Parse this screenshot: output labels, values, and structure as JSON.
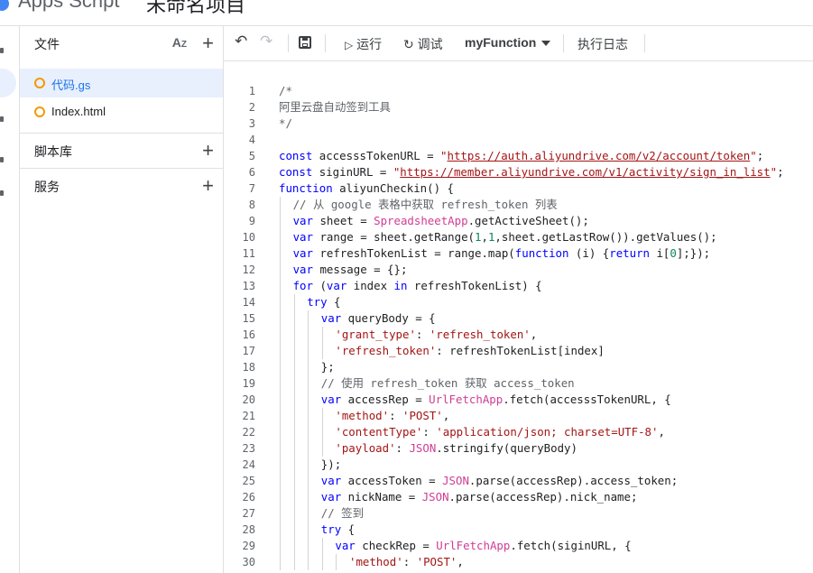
{
  "header": {
    "app_title": "Apps Script",
    "project_name": "未命名项目"
  },
  "sidebar": {
    "files_label": "文件",
    "files": [
      {
        "name": "代码.gs",
        "active": true
      },
      {
        "name": "Index.html",
        "active": false
      }
    ],
    "libraries_label": "脚本库",
    "services_label": "服务"
  },
  "toolbar": {
    "undo_icon": "undo-icon",
    "redo_icon": "redo-icon",
    "save_icon": "save-icon",
    "run_label": "运行",
    "debug_label": "调试",
    "function_select": "myFunction",
    "log_label": "执行日志"
  },
  "colors": {
    "accent": "#1a73e8",
    "active_bg": "#e8f0fe",
    "file_dot": "#f29900",
    "keyword": "#0000ff",
    "string": "#a31515",
    "class": "#d03d93",
    "number": "#098658"
  },
  "editor": {
    "lines": [
      {
        "n": 1,
        "indent": 0,
        "code": [
          [
            "cmt",
            "/*"
          ]
        ]
      },
      {
        "n": 2,
        "indent": 0,
        "code": [
          [
            "cmt",
            "阿里云盘自动签到工具"
          ]
        ]
      },
      {
        "n": 3,
        "indent": 0,
        "code": [
          [
            "cmt",
            "*/"
          ]
        ]
      },
      {
        "n": 4,
        "indent": 0,
        "code": []
      },
      {
        "n": 5,
        "indent": 0,
        "code": [
          [
            "kw",
            "const"
          ],
          [
            "",
            "accesssTokenURL = "
          ],
          [
            "str",
            "\""
          ],
          [
            "url",
            "https://auth.aliyundrive.com/v2/account/token"
          ],
          [
            "str",
            "\""
          ],
          [
            "",
            ";"
          ]
        ]
      },
      {
        "n": 6,
        "indent": 0,
        "code": [
          [
            "kw",
            "const"
          ],
          [
            "",
            "siginURL = "
          ],
          [
            "str",
            "\""
          ],
          [
            "url",
            "https://member.aliyundrive.com/v1/activity/sign_in_list"
          ],
          [
            "str",
            "\""
          ],
          [
            "",
            ";"
          ]
        ]
      },
      {
        "n": 7,
        "indent": 0,
        "code": [
          [
            "kw",
            "function"
          ],
          [
            "",
            "aliyunCheckin() {"
          ]
        ]
      },
      {
        "n": 8,
        "indent": 1,
        "code": [
          [
            "cmt",
            "// 从 google 表格中获取 refresh_token 列表"
          ]
        ]
      },
      {
        "n": 9,
        "indent": 1,
        "code": [
          [
            "kw",
            "var"
          ],
          [
            "",
            "sheet = "
          ],
          [
            "cls",
            "SpreadsheetApp"
          ],
          [
            "",
            ".getActiveSheet();"
          ]
        ]
      },
      {
        "n": 10,
        "indent": 1,
        "code": [
          [
            "kw",
            "var"
          ],
          [
            "",
            "range = sheet.getRange("
          ],
          [
            "num",
            "1"
          ],
          [
            "",
            ","
          ],
          [
            "num",
            "1"
          ],
          [
            "",
            ",sheet.getLastRow()).getValues();"
          ]
        ]
      },
      {
        "n": 11,
        "indent": 1,
        "code": [
          [
            "kw",
            "var"
          ],
          [
            "",
            "refreshTokenList = range.map("
          ],
          [
            "kw",
            "function"
          ],
          [
            "",
            "(i) {"
          ],
          [
            "kw",
            "return"
          ],
          [
            "",
            "i["
          ],
          [
            "num",
            "0"
          ],
          [
            "",
            "];});"
          ]
        ]
      },
      {
        "n": 12,
        "indent": 1,
        "code": [
          [
            "kw",
            "var"
          ],
          [
            "",
            "message = {};"
          ]
        ]
      },
      {
        "n": 13,
        "indent": 1,
        "code": [
          [
            "kw",
            "for"
          ],
          [
            "",
            "("
          ],
          [
            "kw",
            "var"
          ],
          [
            "",
            "index "
          ],
          [
            "kw",
            "in"
          ],
          [
            "",
            "refreshTokenList) {"
          ]
        ]
      },
      {
        "n": 14,
        "indent": 2,
        "code": [
          [
            "kw",
            "try"
          ],
          [
            "",
            "{"
          ]
        ]
      },
      {
        "n": 15,
        "indent": 3,
        "code": [
          [
            "kw",
            "var"
          ],
          [
            "",
            "queryBody = {"
          ]
        ]
      },
      {
        "n": 16,
        "indent": 4,
        "code": [
          [
            "str",
            "'grant_type'"
          ],
          [
            "",
            ": "
          ],
          [
            "str",
            "'refresh_token'"
          ],
          [
            "",
            ","
          ]
        ]
      },
      {
        "n": 17,
        "indent": 4,
        "code": [
          [
            "str",
            "'refresh_token'"
          ],
          [
            "",
            ": refreshTokenList[index]"
          ]
        ]
      },
      {
        "n": 18,
        "indent": 3,
        "code": [
          [
            "",
            "};"
          ]
        ]
      },
      {
        "n": 19,
        "indent": 3,
        "code": [
          [
            "cmt",
            "// 使用 refresh_token 获取 access_token"
          ]
        ]
      },
      {
        "n": 20,
        "indent": 3,
        "code": [
          [
            "kw",
            "var"
          ],
          [
            "",
            "accessRep = "
          ],
          [
            "cls",
            "UrlFetchApp"
          ],
          [
            "",
            ".fetch(accesssTokenURL, {"
          ]
        ]
      },
      {
        "n": 21,
        "indent": 4,
        "code": [
          [
            "str",
            "'method'"
          ],
          [
            "",
            ": "
          ],
          [
            "str",
            "'POST'"
          ],
          [
            "",
            ","
          ]
        ]
      },
      {
        "n": 22,
        "indent": 4,
        "code": [
          [
            "str",
            "'contentType'"
          ],
          [
            "",
            ": "
          ],
          [
            "str",
            "'application/json; charset=UTF-8'"
          ],
          [
            "",
            ","
          ]
        ]
      },
      {
        "n": 23,
        "indent": 4,
        "code": [
          [
            "str",
            "'payload'"
          ],
          [
            "",
            ": "
          ],
          [
            "cls",
            "JSON"
          ],
          [
            "",
            ".stringify(queryBody)"
          ]
        ]
      },
      {
        "n": 24,
        "indent": 3,
        "code": [
          [
            "",
            "});"
          ]
        ]
      },
      {
        "n": 25,
        "indent": 3,
        "code": [
          [
            "kw",
            "var"
          ],
          [
            "",
            "accessToken = "
          ],
          [
            "cls",
            "JSON"
          ],
          [
            "",
            ".parse(accessRep).access_token;"
          ]
        ]
      },
      {
        "n": 26,
        "indent": 3,
        "code": [
          [
            "kw",
            "var"
          ],
          [
            "",
            "nickName = "
          ],
          [
            "cls",
            "JSON"
          ],
          [
            "",
            ".parse(accessRep).nick_name;"
          ]
        ]
      },
      {
        "n": 27,
        "indent": 3,
        "code": [
          [
            "cmt",
            "// 签到"
          ]
        ]
      },
      {
        "n": 28,
        "indent": 3,
        "code": [
          [
            "kw",
            "try"
          ],
          [
            "",
            "{"
          ]
        ]
      },
      {
        "n": 29,
        "indent": 4,
        "code": [
          [
            "kw",
            "var"
          ],
          [
            "",
            "checkRep = "
          ],
          [
            "cls",
            "UrlFetchApp"
          ],
          [
            "",
            ".fetch(siginURL, {"
          ]
        ]
      },
      {
        "n": 30,
        "indent": 5,
        "code": [
          [
            "str",
            "'method'"
          ],
          [
            "",
            ": "
          ],
          [
            "str",
            "'POST'"
          ],
          [
            "",
            ","
          ]
        ]
      }
    ]
  }
}
